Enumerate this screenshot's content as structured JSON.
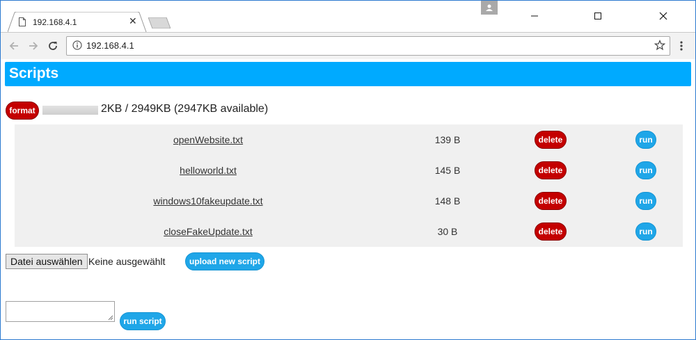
{
  "browser": {
    "tab_title": "192.168.4.1",
    "url": "192.168.4.1"
  },
  "page": {
    "title": "Scripts",
    "format_label": "format",
    "usage_text": "2KB / 2949KB (2947KB available)",
    "usage_fraction": 0.0007,
    "files": [
      {
        "name": "openWebsite.txt",
        "size": "139 B"
      },
      {
        "name": "helloworld.txt",
        "size": "145 B"
      },
      {
        "name": "windows10fakeupdate.txt",
        "size": "148 B"
      },
      {
        "name": "closeFakeUpdate.txt",
        "size": "30 B"
      }
    ],
    "delete_label": "delete",
    "run_label": "run",
    "choose_file_label": "Datei auswählen",
    "no_file_label": "Keine ausgewählt",
    "upload_label": "upload new script",
    "command_value": "",
    "run_script_label": "run script"
  },
  "colors": {
    "header": "#00aaff",
    "danger": "#c40000",
    "primary": "#1fa6e8",
    "table_bg": "#f0f0f0"
  },
  "icons": [
    "page-icon",
    "close-icon",
    "user-icon",
    "minimize-icon",
    "maximize-icon",
    "window-close-icon",
    "back-arrow-icon",
    "forward-arrow-icon",
    "reload-icon",
    "info-icon",
    "star-icon",
    "menu-dots-icon"
  ]
}
